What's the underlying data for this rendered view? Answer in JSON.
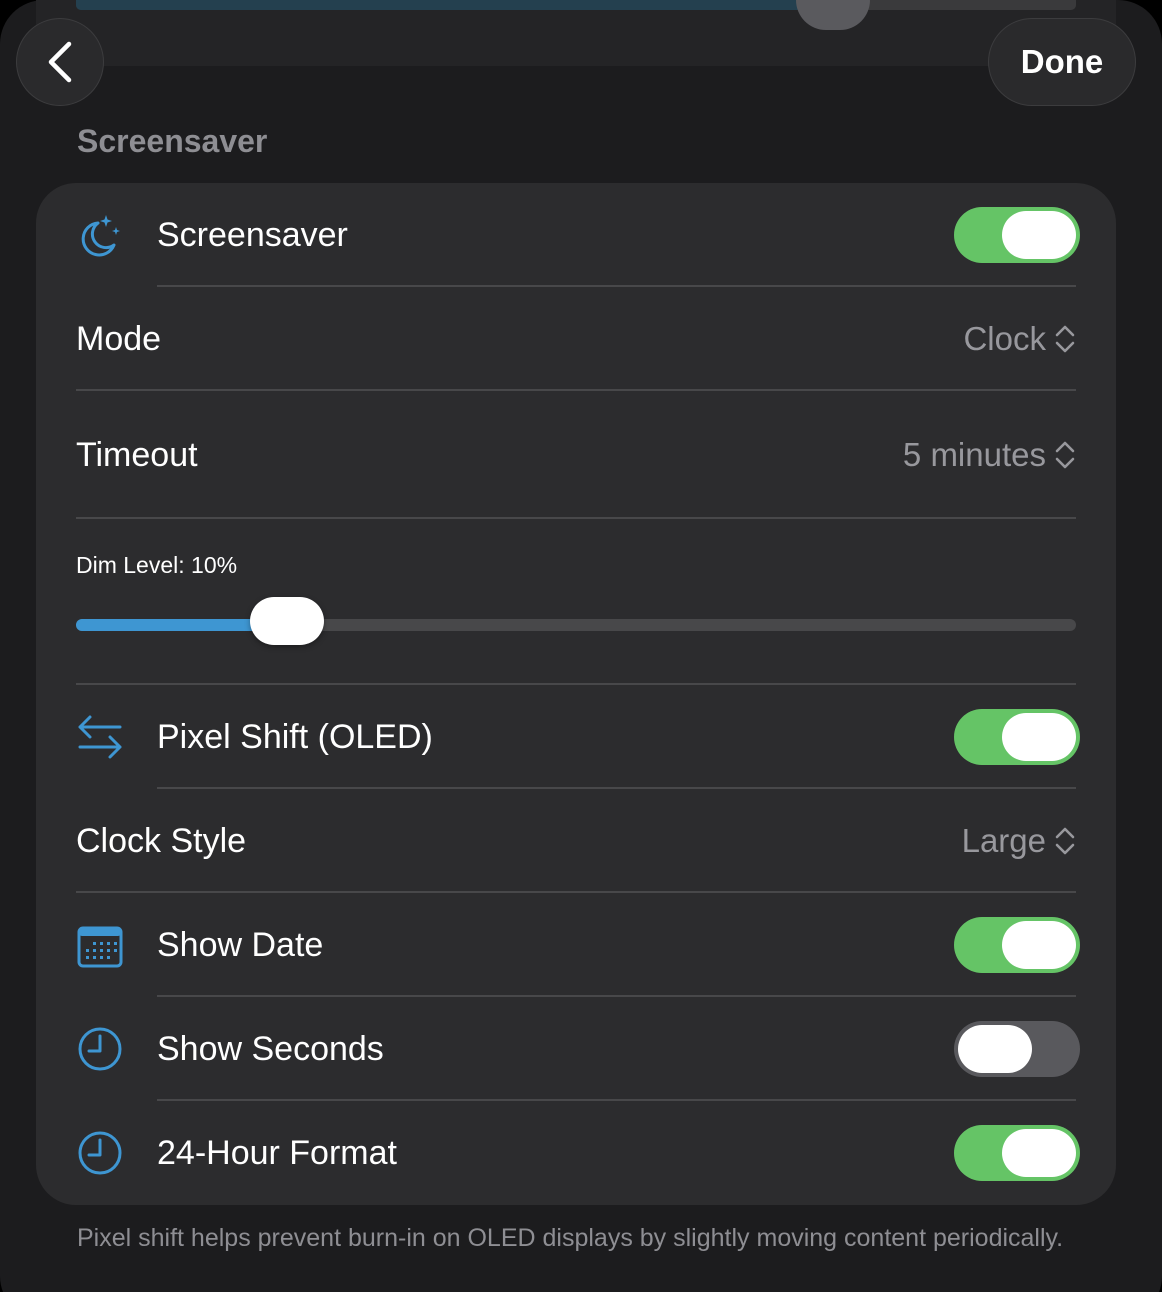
{
  "nav": {
    "back_icon": "chevron-left-icon",
    "done_label": "Done"
  },
  "top_slider": {
    "level": 0.72
  },
  "section": {
    "title": "Screensaver"
  },
  "rows": {
    "screensaver": {
      "label": "Screensaver",
      "icon": "moon-stars-icon",
      "enabled": true
    },
    "mode": {
      "label": "Mode",
      "value": "Clock"
    },
    "timeout": {
      "label": "Timeout",
      "value": "5 minutes"
    },
    "dim": {
      "label": "Dim Level: 10%",
      "level": 0.1
    },
    "pixel_shift": {
      "label": "Pixel Shift (OLED)",
      "icon": "arrows-left-right-icon",
      "enabled": true
    },
    "clock_style": {
      "label": "Clock Style",
      "value": "Large"
    },
    "show_date": {
      "label": "Show Date",
      "icon": "calendar-icon",
      "enabled": true
    },
    "show_seconds": {
      "label": "Show Seconds",
      "icon": "clock-icon",
      "enabled": false
    },
    "hour24": {
      "label": "24-Hour Format",
      "icon": "clock-icon",
      "enabled": true
    }
  },
  "footer": {
    "note": "Pixel shift helps prevent burn-in on OLED displays by slightly moving content periodically."
  },
  "colors": {
    "accent": "#3e96d2",
    "toggle_on": "#65c466",
    "toggle_off": "#59595d",
    "card": "#2c2c2e",
    "background": "#1c1c1e"
  }
}
